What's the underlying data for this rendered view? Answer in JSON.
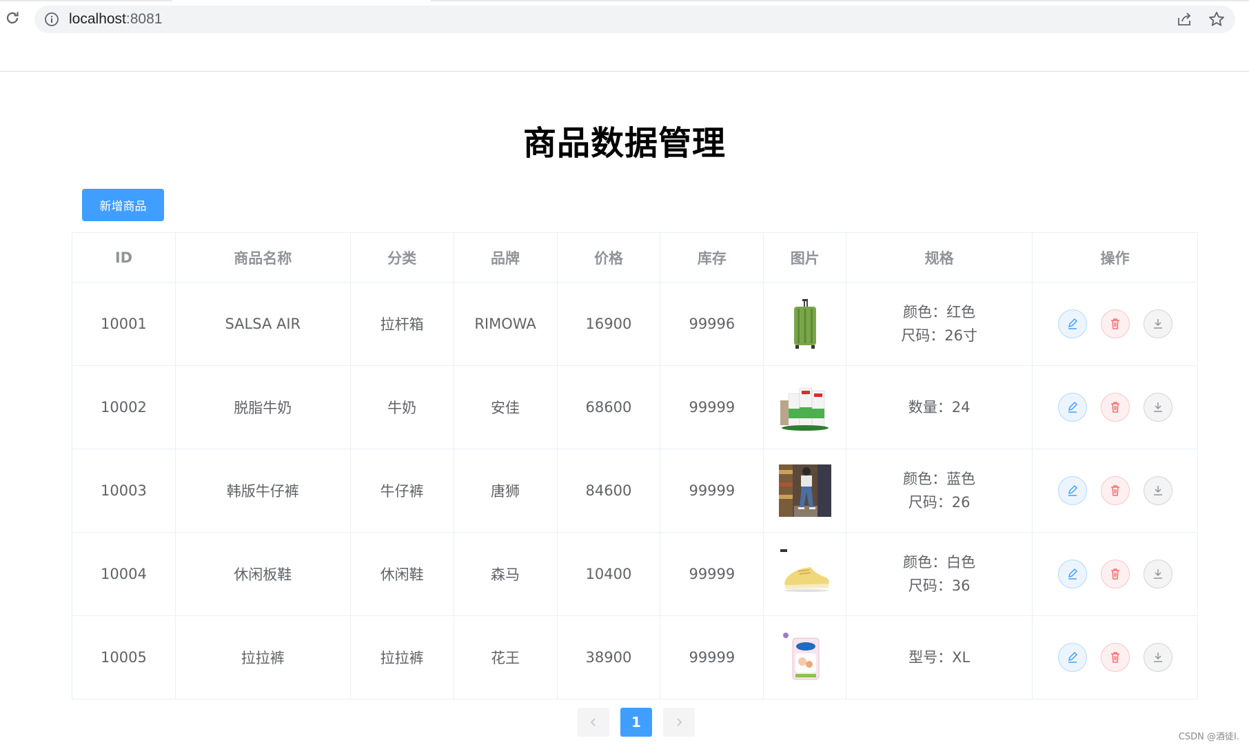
{
  "browser": {
    "url_host": "localhost",
    "url_port": ":8081"
  },
  "page": {
    "title": "商品数据管理",
    "add_button": "新增商品"
  },
  "table": {
    "headers": [
      "ID",
      "商品名称",
      "分类",
      "品牌",
      "价格",
      "库存",
      "图片",
      "规格",
      "操作"
    ],
    "rows": [
      {
        "id": "10001",
        "name": "SALSA AIR",
        "category": "拉杆箱",
        "brand": "RIMOWA",
        "price": "16900",
        "stock": "99996",
        "image": "green-suitcase",
        "spec1": "颜色：红色",
        "spec2": "尺码：26寸"
      },
      {
        "id": "10002",
        "name": "脱脂牛奶",
        "category": "牛奶",
        "brand": "安佳",
        "price": "68600",
        "stock": "99999",
        "image": "milk-cartons",
        "spec1": "数量：24",
        "spec2": ""
      },
      {
        "id": "10003",
        "name": "韩版牛仔裤",
        "category": "牛仔裤",
        "brand": "唐狮",
        "price": "84600",
        "stock": "99999",
        "image": "jeans-photo",
        "spec1": "颜色：蓝色",
        "spec2": "尺码：26"
      },
      {
        "id": "10004",
        "name": "休闲板鞋",
        "category": "休闲鞋",
        "brand": "森马",
        "price": "10400",
        "stock": "99999",
        "image": "yellow-sneaker",
        "spec1": "颜色：白色",
        "spec2": "尺码：36"
      },
      {
        "id": "10005",
        "name": "拉拉裤",
        "category": "拉拉裤",
        "brand": "花王",
        "price": "38900",
        "stock": "99999",
        "image": "diaper-pack",
        "spec1": "型号：XL",
        "spec2": ""
      }
    ]
  },
  "pagination": {
    "current": "1"
  },
  "watermark": "CSDN @酒徒I.",
  "colors": {
    "primary": "#409eff",
    "danger": "#f56c6c",
    "info": "#909399"
  }
}
